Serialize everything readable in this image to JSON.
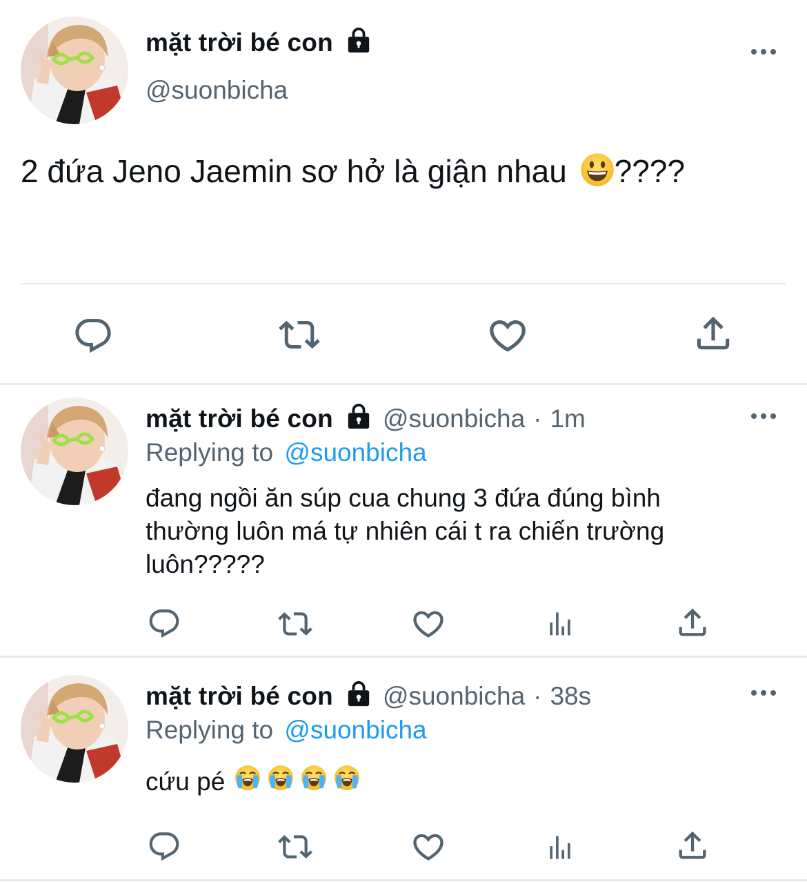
{
  "main_tweet": {
    "display_name": "mặt trời bé con",
    "handle": "@suonbicha",
    "text": "2 đứa Jeno Jaemin sơ hở là giận nhau",
    "text_suffix": "????"
  },
  "replies": [
    {
      "display_name": "mặt trời bé con",
      "handle": "@suonbicha",
      "dot": "·",
      "time": "1m",
      "replying_prefix": "Replying to",
      "replying_handle": "@suonbicha",
      "line1": "đang ngồi ăn súp cua chung 3 đứa đúng bình",
      "line2": "thường luôn má tự nhiên cái t ra chiến trường",
      "line3": "luôn?????"
    },
    {
      "display_name": "mặt trời bé con",
      "handle": "@suonbicha",
      "dot": "·",
      "time": "38s",
      "replying_prefix": "Replying to",
      "replying_handle": "@suonbicha",
      "text": "cứu pé"
    }
  ],
  "icons": {
    "reply": "reply-icon",
    "retweet": "retweet-icon",
    "like": "heart-icon",
    "share": "share-icon",
    "analytics": "analytics-icon",
    "lock": "lock-icon",
    "more": "more-icon",
    "grinning": "grinning-face-emoji",
    "crying": "loudly-crying-face-emoji"
  },
  "colors": {
    "text": "#0f1419",
    "secondary": "#536471",
    "link": "#1d9bf0",
    "divider": "#e7e9ea"
  }
}
